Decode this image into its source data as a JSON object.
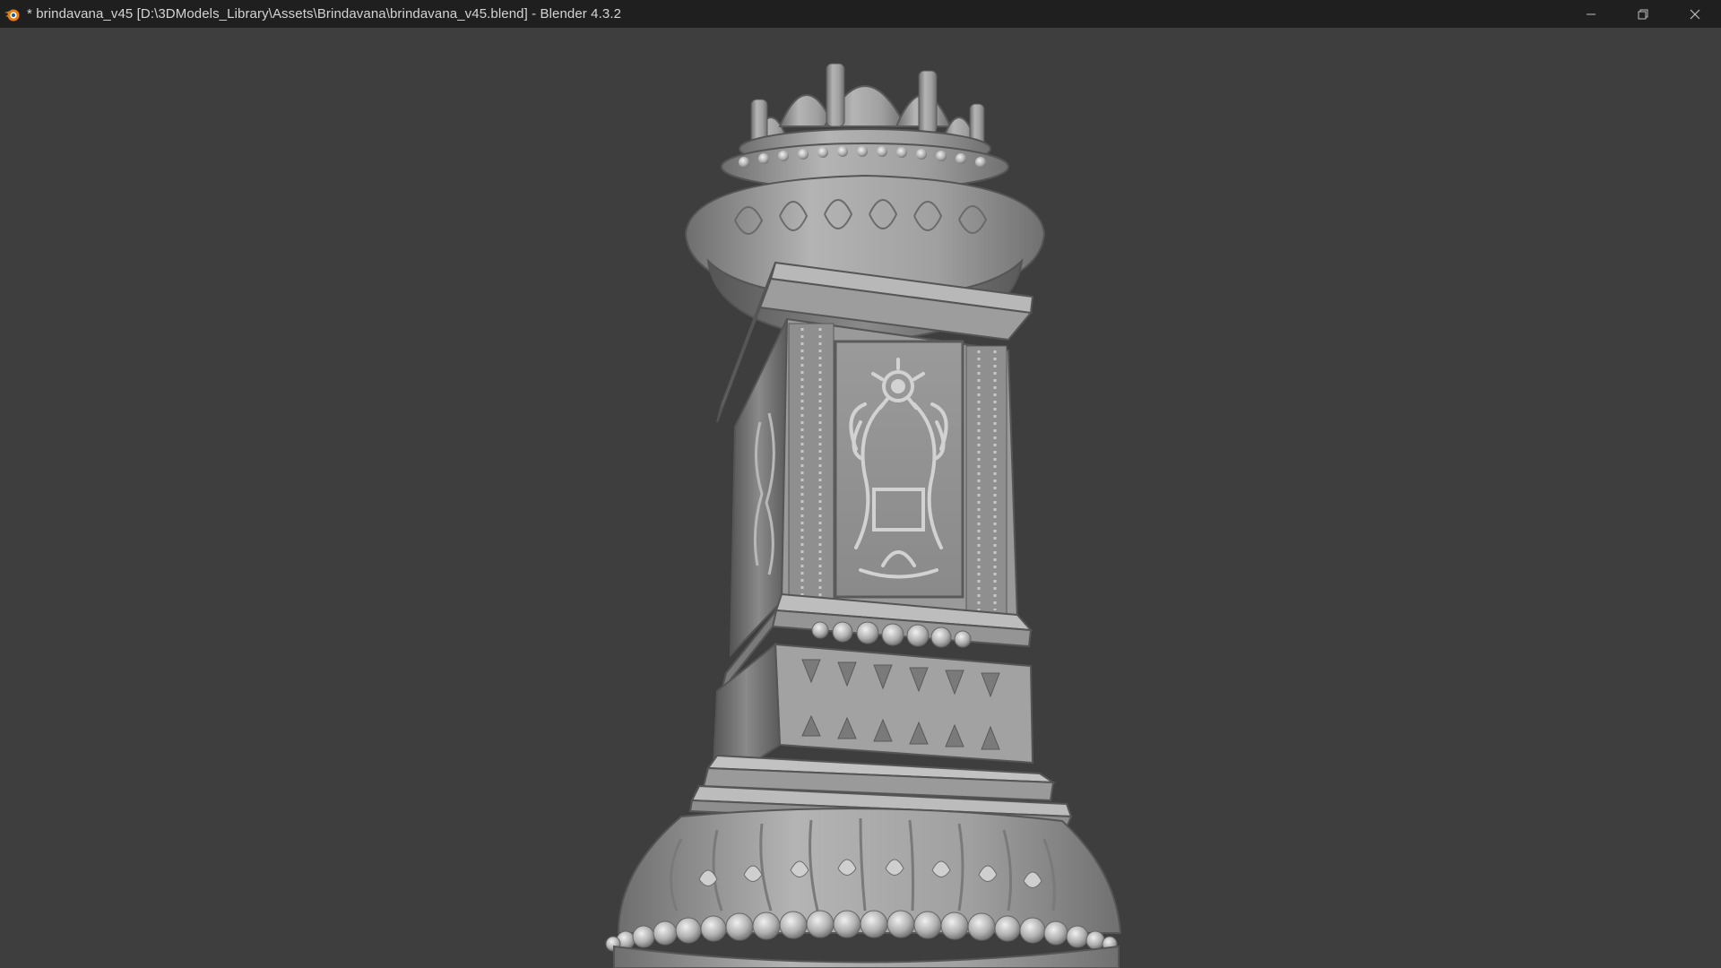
{
  "window": {
    "title": "* brindavana_v45 [D:\\3DModels_Library\\Assets\\Brindavana\\brindavana_v45.blend] - Blender 4.3.2",
    "app_icon": "blender-logo-icon",
    "controls": {
      "minimize_icon": "minimize-icon",
      "restore_icon": "restore-icon",
      "close_icon": "close-icon"
    }
  },
  "viewport": {
    "object": "brindavana 3D model",
    "background_color": "#3e3e3e",
    "model_color": "#a8a8a8"
  },
  "colors": {
    "titlebar_bg": "#1f1f1f",
    "titlebar_text": "#d4d4d4",
    "blender_orange": "#e87d0d"
  }
}
